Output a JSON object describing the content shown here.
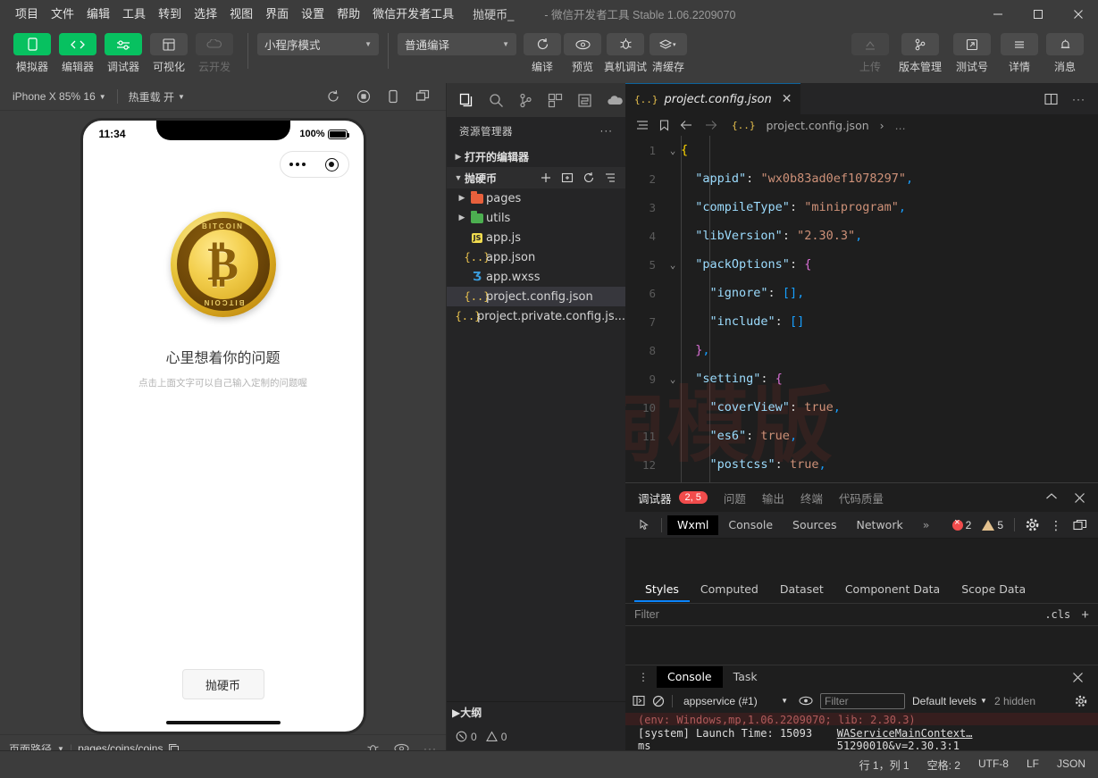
{
  "window": {
    "title": "- 微信开发者工具 Stable 1.06.2209070",
    "project_name": "抛硬币_",
    "minimize": "—",
    "maximize": "□",
    "close": "✕"
  },
  "menubar": {
    "items": [
      "项目",
      "文件",
      "编辑",
      "工具",
      "转到",
      "选择",
      "视图",
      "界面",
      "设置",
      "帮助",
      "微信开发者工具"
    ]
  },
  "toolbar": {
    "left_buttons": [
      {
        "label": "模拟器",
        "icon": "phone-icon",
        "state": "active"
      },
      {
        "label": "编辑器",
        "icon": "code-icon",
        "state": "active"
      },
      {
        "label": "调试器",
        "icon": "debug-icon",
        "state": "active"
      },
      {
        "label": "可视化",
        "icon": "layout-icon",
        "state": "normal"
      },
      {
        "label": "云开发",
        "icon": "cloud-icon",
        "state": "disabled"
      }
    ],
    "mode_select": "小程序模式",
    "compile_select": "普通编译",
    "actions": [
      {
        "label": "编译",
        "icon": "refresh-icon"
      },
      {
        "label": "预览",
        "icon": "eye-icon"
      },
      {
        "label": "真机调试",
        "icon": "bug-icon"
      },
      {
        "label": "清缓存",
        "icon": "layers-icon"
      }
    ],
    "right_actions": [
      {
        "label": "上传",
        "icon": "upload-icon",
        "state": "disabled"
      },
      {
        "label": "版本管理",
        "icon": "branch-icon",
        "state": "normal"
      },
      {
        "label": "测试号",
        "icon": "external-link-icon",
        "state": "normal"
      },
      {
        "label": "详情",
        "icon": "menu-icon",
        "state": "normal"
      },
      {
        "label": "消息",
        "icon": "bell-icon",
        "state": "normal"
      }
    ]
  },
  "simulator": {
    "device": "iPhone X 85% 16",
    "hot_reload": "热重载 开",
    "toolbar_icons": [
      "refresh-icon",
      "record-icon",
      "device-rotate-icon",
      "multi-window-icon"
    ],
    "phone": {
      "time": "11:34",
      "battery_percent": "100%",
      "question_title": "心里想着你的问题",
      "question_sub": "点击上面文字可以自己输入定制的问题喔",
      "flip_button": "抛硬币",
      "coin_top_word": "BITCOIN",
      "coin_bottom_word": "BITCOIN",
      "coin_symbol": "₿"
    },
    "footer": {
      "path_label": "页面路径",
      "path_value": "pages/coins/coins",
      "icons": [
        "bug-icon",
        "eye-icon",
        "more-icon"
      ]
    }
  },
  "explorer": {
    "activity_icons": [
      "files-icon",
      "search-icon",
      "source-control-icon",
      "extensions-icon",
      "wxml-panel-icon",
      "cloud-icon"
    ],
    "header": "资源管理器",
    "header_more": "···",
    "open_editors": "打开的编辑器",
    "project_root": "抛硬币",
    "root_tools": [
      "new-file-icon",
      "new-folder-icon",
      "refresh-icon",
      "collapse-all-icon"
    ],
    "files": [
      {
        "name": "pages",
        "type": "folder",
        "color": "#e8603c",
        "expandable": true
      },
      {
        "name": "utils",
        "type": "folder",
        "color": "#4caf50",
        "expandable": true
      },
      {
        "name": "app.js",
        "type": "js",
        "color": "#f0db4f",
        "expandable": false
      },
      {
        "name": "app.json",
        "type": "json",
        "color": "#e8c14d",
        "expandable": false
      },
      {
        "name": "app.wxss",
        "type": "wxss",
        "color": "#3b9ddd",
        "expandable": false
      },
      {
        "name": "project.config.json",
        "type": "json",
        "color": "#e8c14d",
        "expandable": false,
        "selected": true
      },
      {
        "name": "project.private.config.js...",
        "type": "json",
        "color": "#e8c14d",
        "expandable": false
      }
    ],
    "outline": "大纲",
    "footer": {
      "errors": "0",
      "warnings": "0"
    }
  },
  "editor": {
    "tab": {
      "name": "project.config.json",
      "close": "✕"
    },
    "tab_actions": [
      "split-editor-icon",
      "more-actions-icon"
    ],
    "breadcrumb": {
      "icons": [
        "outline-icon",
        "bookmark-icon",
        "back-arrow-icon",
        "forward-arrow-icon"
      ],
      "file": "project.config.json",
      "separator": "›",
      "trail": "..."
    },
    "lines": [
      {
        "n": "1",
        "fold": "v",
        "html": "<span class='br2'>{</span>"
      },
      {
        "n": "2",
        "fold": "",
        "html": "  <span class='k'>\"appid\"</span><span class='p'>: </span><span class='s'>\"wx0b83ad0ef1078297\"</span><span class='br3'>,</span>"
      },
      {
        "n": "3",
        "fold": "",
        "html": "  <span class='k'>\"compileType\"</span><span class='p'>: </span><span class='s'>\"miniprogram\"</span><span class='br3'>,</span>"
      },
      {
        "n": "4",
        "fold": "",
        "html": "  <span class='k'>\"libVersion\"</span><span class='p'>: </span><span class='s'>\"2.30.3\"</span><span class='br3'>,</span>"
      },
      {
        "n": "5",
        "fold": "v",
        "html": "  <span class='k'>\"packOptions\"</span><span class='p'>: </span><span class='br'>{</span>"
      },
      {
        "n": "6",
        "fold": "",
        "html": "    <span class='k'>\"ignore\"</span><span class='p'>: </span><span class='br3'>[]</span><span class='br3'>,</span>"
      },
      {
        "n": "7",
        "fold": "",
        "html": "    <span class='k'>\"include\"</span><span class='p'>: </span><span class='br3'>[]</span>"
      },
      {
        "n": "8",
        "fold": "",
        "html": "  <span class='br'>}</span><span class='br3'>,</span>"
      },
      {
        "n": "9",
        "fold": "v",
        "html": "  <span class='k'>\"setting\"</span><span class='p'>: </span><span class='br'>{</span>"
      },
      {
        "n": "10",
        "fold": "",
        "html": "    <span class='k'>\"coverView\"</span><span class='p'>: </span><span class='s'>true</span><span class='br3'>,</span>"
      },
      {
        "n": "11",
        "fold": "",
        "html": "    <span class='k'>\"es6\"</span><span class='p'>: </span><span class='s'>true</span><span class='br3'>,</span>"
      },
      {
        "n": "12",
        "fold": "",
        "html": "    <span class='k'>\"postcss\"</span><span class='p'>: </span><span class='s'>true</span><span class='br3'>,</span>"
      }
    ],
    "watermark": "一淘模版"
  },
  "debugger": {
    "panel_tabs": [
      "调试器",
      "问题",
      "输出",
      "终端",
      "代码质量"
    ],
    "active_panel_tab": "调试器",
    "panel_badge": "2, 5",
    "panel_controls": [
      "collapse-icon",
      "close-icon"
    ],
    "devtools_tabs": [
      "Wxml",
      "Console",
      "Sources",
      "Network"
    ],
    "devtools_active": "Wxml",
    "devtools_more": "»",
    "error_count": "2",
    "warning_count": "5",
    "devtools_right_icons": [
      "settings-gear-icon",
      "more-vertical-icon",
      "dock-icon"
    ],
    "styles_tabs": [
      "Styles",
      "Computed",
      "Dataset",
      "Component Data",
      "Scope Data"
    ],
    "styles_active": "Styles",
    "filter_placeholder": "Filter",
    "cls_label": ".cls",
    "plus_label": "+",
    "console_tabs": [
      "Console",
      "Task"
    ],
    "console_active": "Console",
    "console_context": "appservice (#1)",
    "console_filter_placeholder": "Filter",
    "console_levels": "Default levels",
    "console_hidden": "2 hidden",
    "log_error_line": "(env: Windows,mp,1.06.2209070; lib: 2.30.3)",
    "log_message": "[system] Launch Time: 15093 ms",
    "log_link": "WAServiceMainContext…51290010&v=2.30.3:1",
    "prompt": "›"
  },
  "statusbar": {
    "cursor": "行 1，列 1",
    "spaces": "空格: 2",
    "encoding": "UTF-8",
    "eol": "LF",
    "language": "JSON"
  },
  "colors": {
    "accent_green": "#07c160",
    "error_red": "#f14c4c",
    "warn_yellow": "#e2c08d",
    "link_blue": "#0a84ff"
  }
}
